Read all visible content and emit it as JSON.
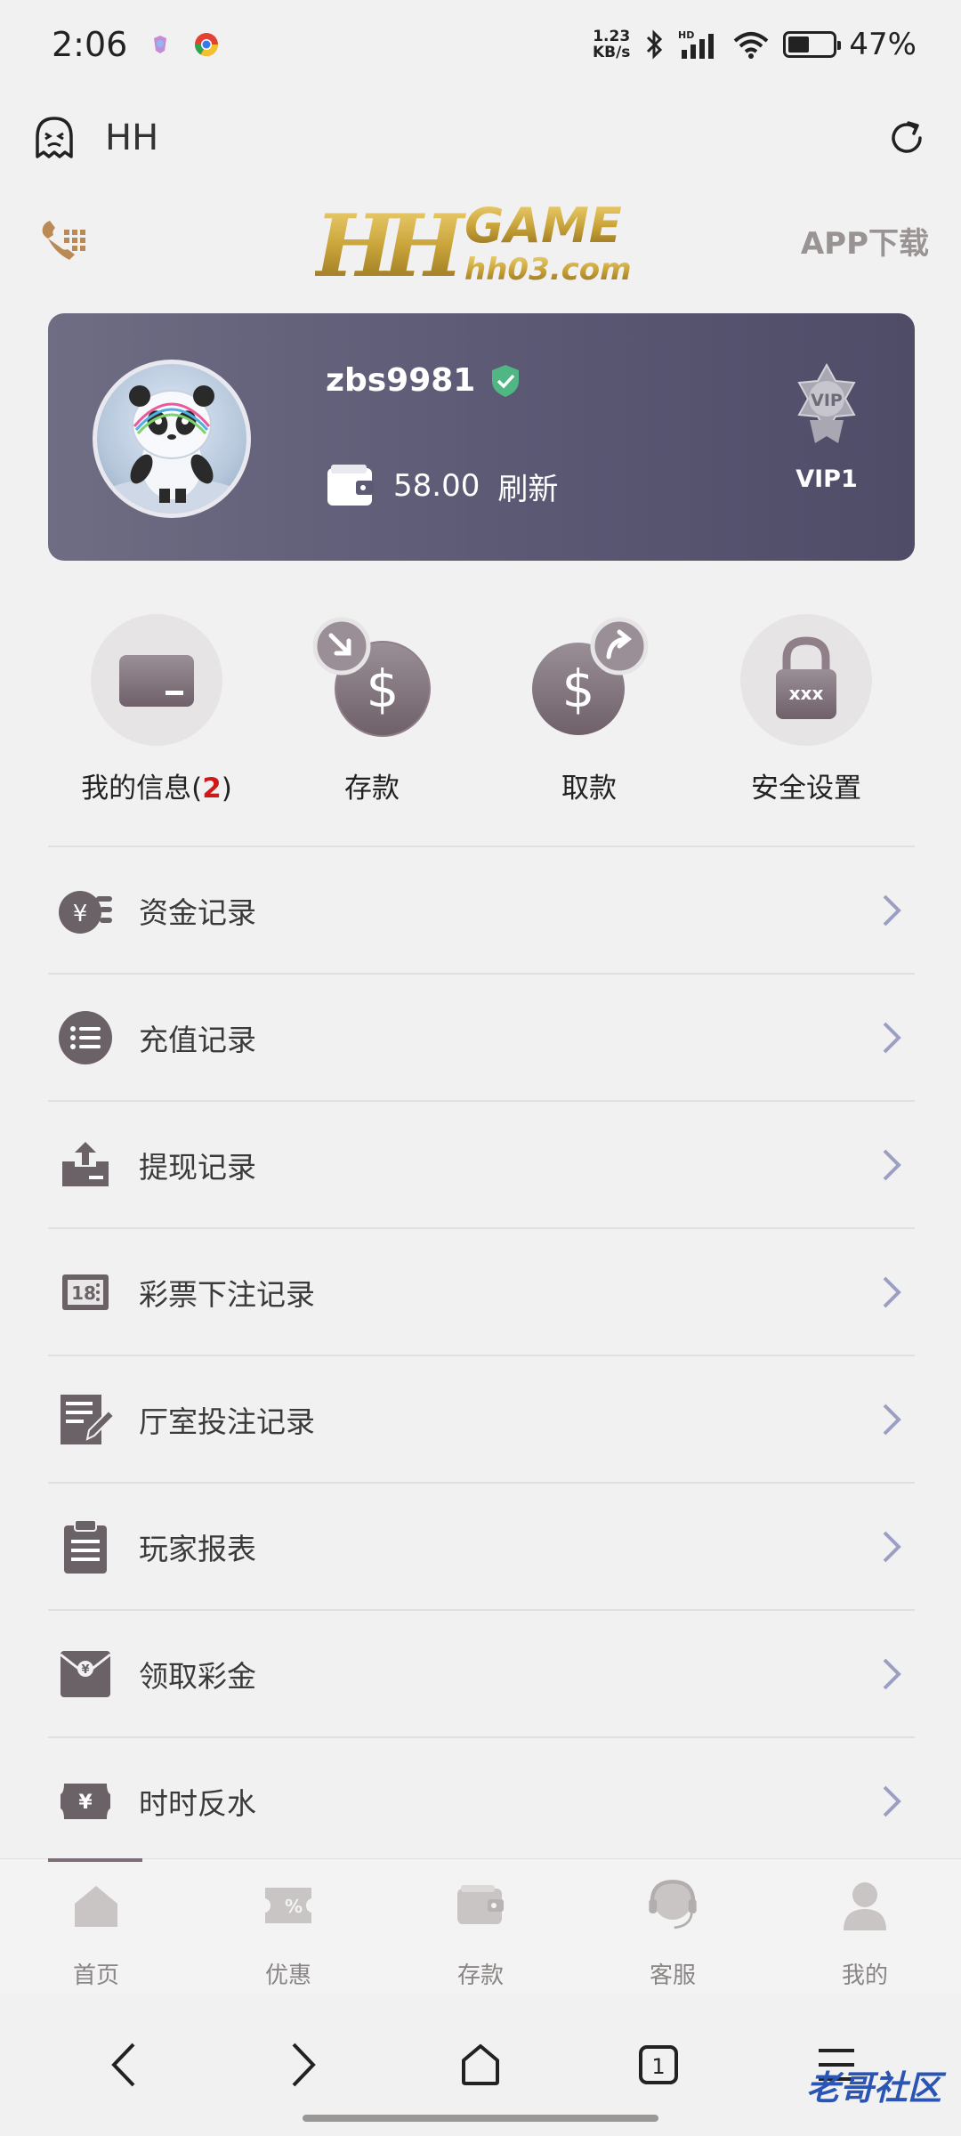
{
  "status_bar": {
    "time": "2:06",
    "speed": "1.23",
    "speed_unit": "KB/s",
    "network": "HD",
    "battery": "47%",
    "battery_level": 0.47
  },
  "top_bar": {
    "title": "HH"
  },
  "brand": {
    "logo_text": "HH GAME",
    "logo_domain": "hh03.com",
    "app_download": "APP下载"
  },
  "user": {
    "username": "zbs9981",
    "balance": "58.00",
    "refresh_label": "刷新",
    "vip_label": "VIP1",
    "vip_badge_text": "VIP"
  },
  "quick_actions": [
    {
      "label": "我的信息(",
      "badge": "2",
      "suffix": ")"
    },
    {
      "label": "存款"
    },
    {
      "label": "取款"
    },
    {
      "label": "安全设置"
    }
  ],
  "menu": [
    {
      "label": "资金记录"
    },
    {
      "label": "充值记录"
    },
    {
      "label": "提现记录"
    },
    {
      "label": "彩票下注记录"
    },
    {
      "label": "厅室投注记录"
    },
    {
      "label": "玩家报表"
    },
    {
      "label": "领取彩金"
    },
    {
      "label": "时时反水"
    }
  ],
  "tabs": [
    {
      "label": "首页"
    },
    {
      "label": "优惠"
    },
    {
      "label": "存款"
    },
    {
      "label": "客服"
    },
    {
      "label": "我的"
    }
  ],
  "nav": {
    "tab_count": "1"
  },
  "watermark": "老哥社区",
  "colors": {
    "accent": "#5c5a75",
    "badge": "#d01a1a",
    "gold": "#c9a43a"
  }
}
